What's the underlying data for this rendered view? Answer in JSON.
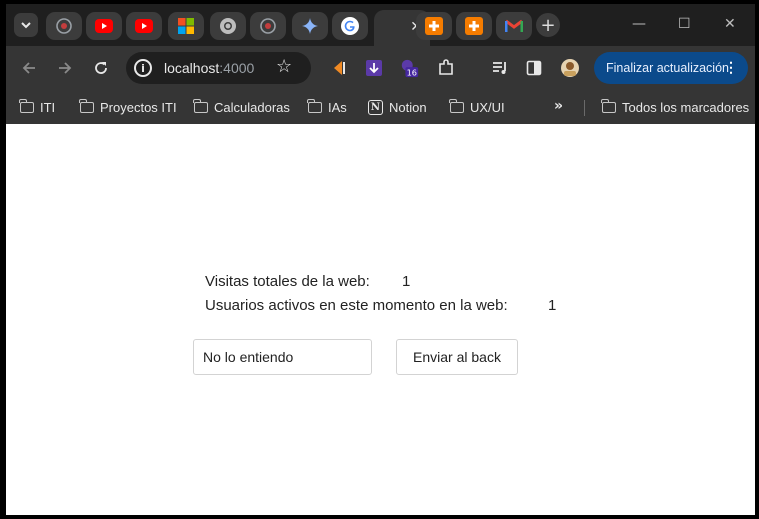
{
  "browser": {
    "tabs": [
      {
        "icon": "loader-icon",
        "color": "#c33d3d"
      },
      {
        "icon": "youtube-icon",
        "color": "#ff0000"
      },
      {
        "icon": "youtube-icon",
        "color": "#ff0000"
      },
      {
        "icon": "microsoft-icon",
        "color": "#f25022"
      },
      {
        "icon": "chrome-icon",
        "color": "#9aa0a6"
      },
      {
        "icon": "loader-icon",
        "color": "#c33d3d"
      },
      {
        "icon": "gemini-icon",
        "color": "#8ab4f8"
      },
      {
        "icon": "google-icon",
        "color": "#4285f4",
        "active": true
      },
      {
        "icon": "plus-app-icon",
        "color": "#f57c00"
      },
      {
        "icon": "plus-app-icon",
        "color": "#f57c00"
      },
      {
        "icon": "gmail-icon",
        "color": "#ea4335"
      }
    ],
    "address": {
      "host": "localhost",
      "port": ":4000"
    },
    "update_button": "Finalizar actualización",
    "bookmarks": [
      "ITI",
      "Proyectos ITI",
      "Calculadoras",
      "IAs",
      "Notion",
      "UX/UI"
    ],
    "all_bookmarks": "Todos los marcadores",
    "extension_badge": "16"
  },
  "page": {
    "total_visits_label": "Visitas totales de la web:",
    "total_visits_value": "1",
    "active_users_label": "Usuarios activos en este momento en la web:",
    "active_users_value": "1",
    "message_input_value": "No lo entiendo",
    "send_button": "Enviar al back"
  },
  "colors": {
    "accent": "#0b4a8b",
    "chrome_dark": "#1f1f1f",
    "toolbar": "#353535"
  }
}
